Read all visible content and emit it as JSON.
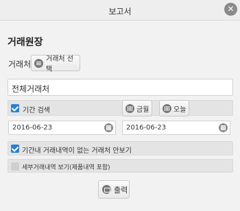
{
  "window": {
    "title": "보고서",
    "close_icon": "close-icon"
  },
  "form": {
    "heading": "거래원장",
    "partner_label": "거래처",
    "partner_button": "거래처 선택",
    "partner_value": "전체거래처",
    "period_search": {
      "label": "기간 검색",
      "checked": true
    },
    "month_button": "금월",
    "today_button": "오늘",
    "date_from": "2016-06-23",
    "date_to": "2016-06-23",
    "exclude_no_trades": {
      "label": "기간내 거래내역이 없는 거래처 안보기",
      "checked": true
    },
    "detail_view": {
      "label": "세부거래내역 보기(제품내역 포함)",
      "checked": false
    },
    "print_button": "출력"
  },
  "colors": {
    "accent": "#2b7fd0",
    "background": "#f2f2f2",
    "titlebar": "#eeeeee"
  }
}
